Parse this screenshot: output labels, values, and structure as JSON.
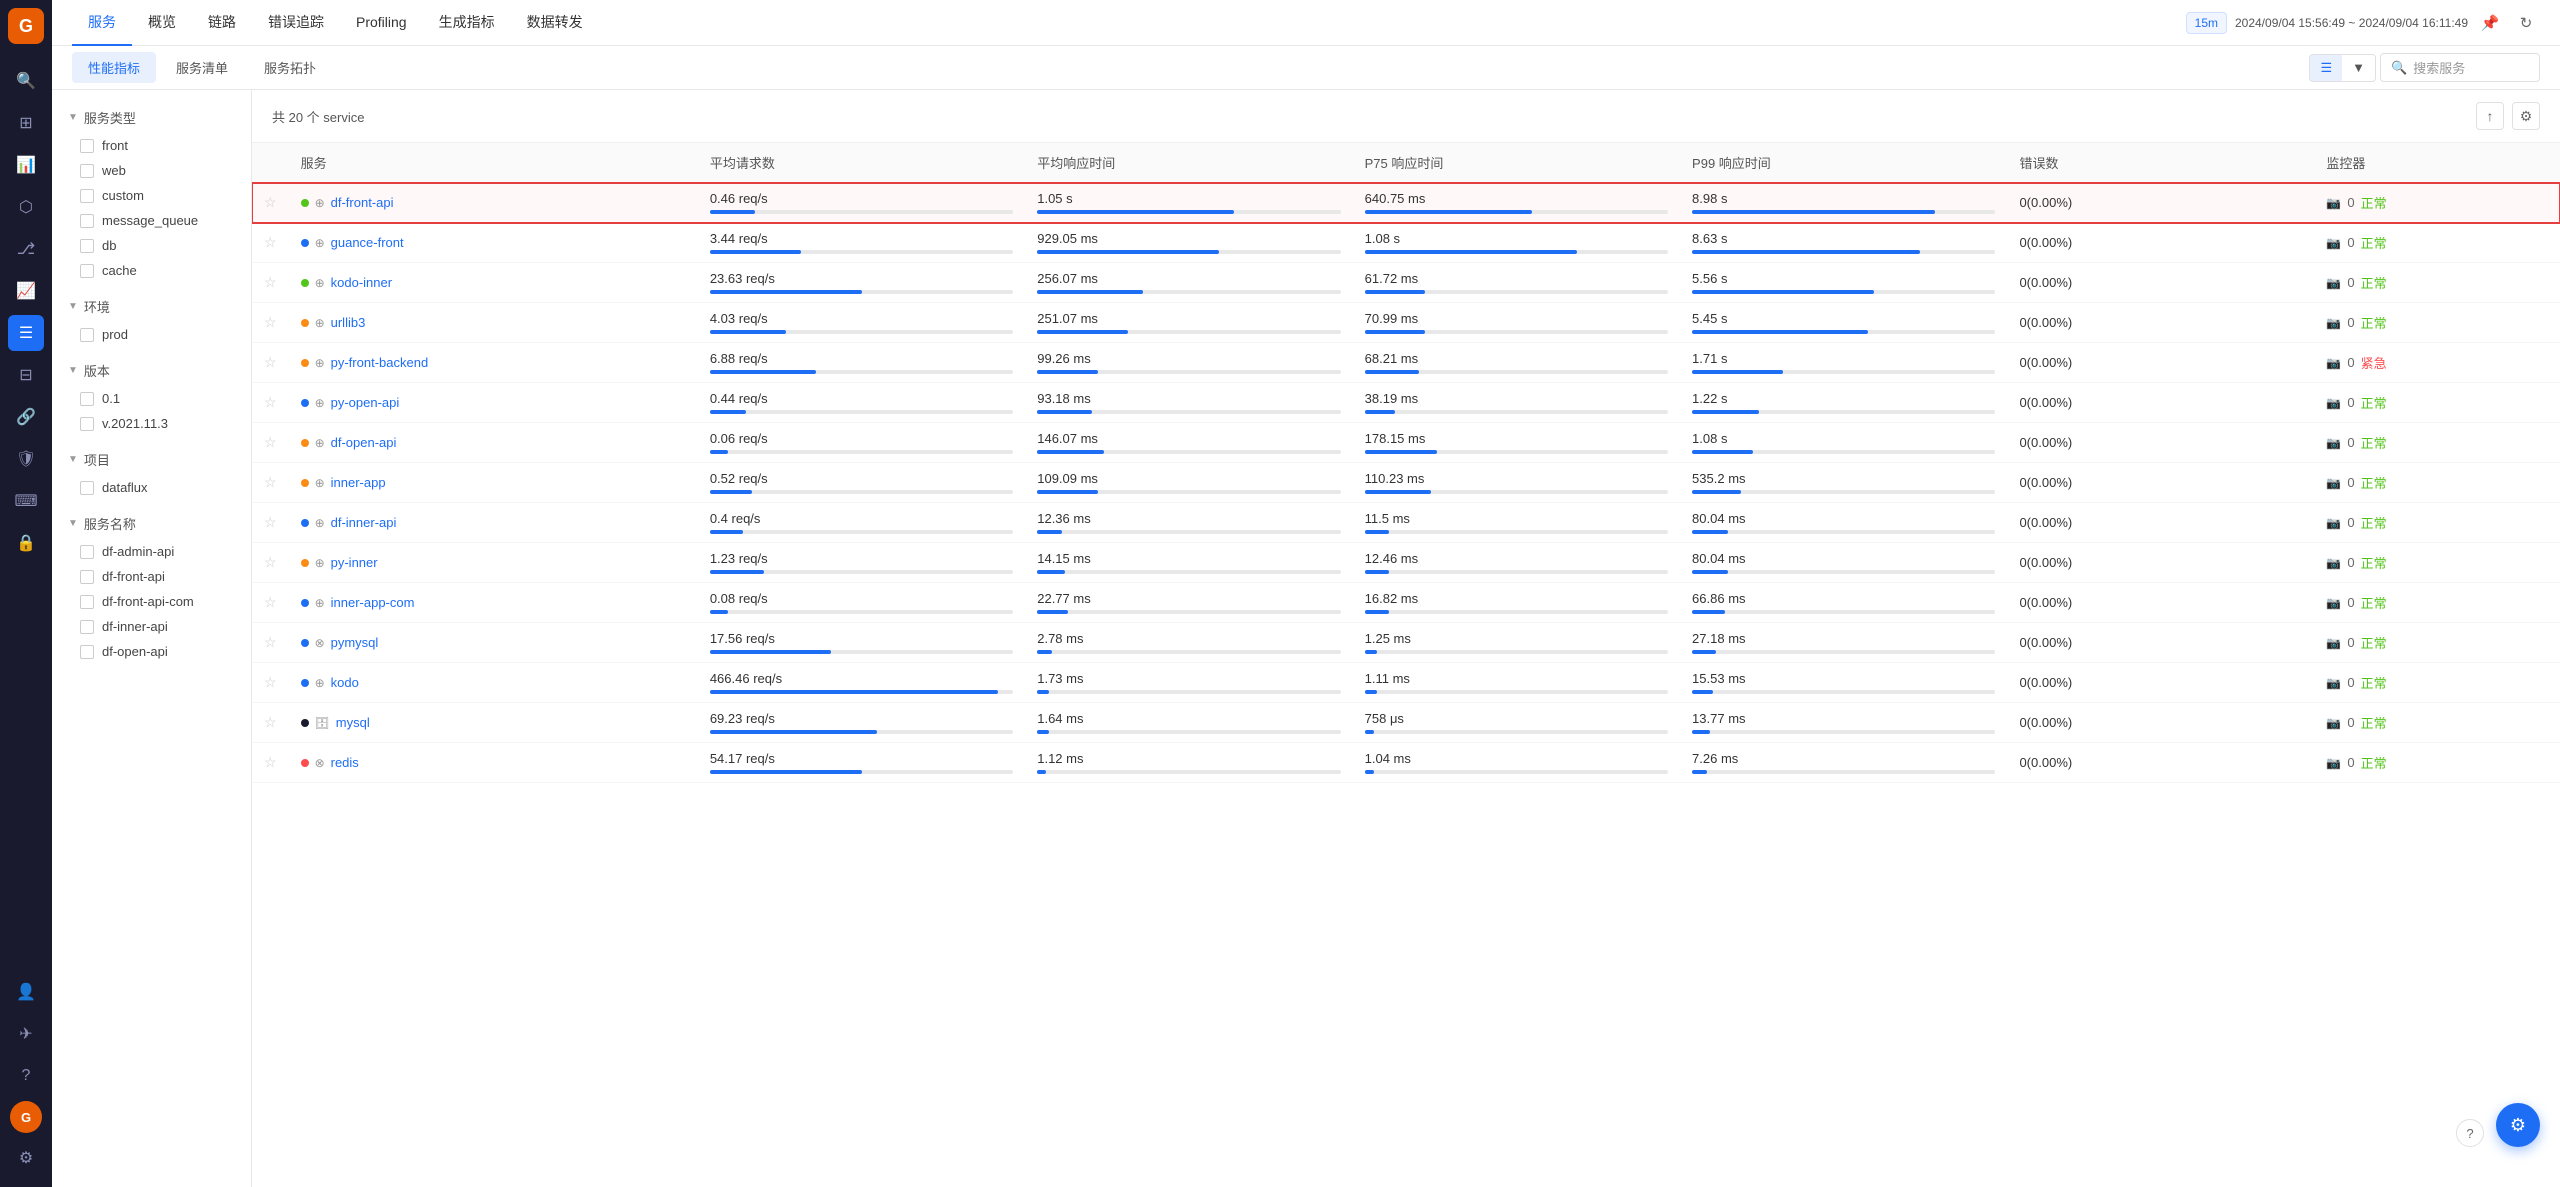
{
  "sidebar": {
    "logo": "G",
    "icons": [
      {
        "name": "search",
        "symbol": "🔍",
        "active": false
      },
      {
        "name": "dashboard",
        "symbol": "⊞",
        "active": false
      },
      {
        "name": "chart-bar",
        "symbol": "📊",
        "active": false
      },
      {
        "name": "topology",
        "symbol": "⬡",
        "active": false
      },
      {
        "name": "branch",
        "symbol": "⎇",
        "active": false
      },
      {
        "name": "analytics",
        "symbol": "📈",
        "active": false
      },
      {
        "name": "list",
        "symbol": "☰",
        "active": true
      },
      {
        "name": "grid",
        "symbol": "⊟",
        "active": false
      },
      {
        "name": "link",
        "symbol": "🔗",
        "active": false
      },
      {
        "name": "shield",
        "symbol": "🛡",
        "active": false
      },
      {
        "name": "terminal",
        "symbol": "⌨",
        "active": false
      },
      {
        "name": "lock",
        "symbol": "🔒",
        "active": false
      },
      {
        "name": "settings-bottom",
        "symbol": "⚙",
        "active": false
      }
    ],
    "bottom_icons": [
      {
        "name": "user-search",
        "symbol": "👤"
      },
      {
        "name": "send",
        "symbol": "✈"
      },
      {
        "name": "help",
        "symbol": "?"
      }
    ],
    "avatar": "G"
  },
  "nav": {
    "items": [
      {
        "label": "服务",
        "active": true
      },
      {
        "label": "概览",
        "active": false
      },
      {
        "label": "链路",
        "active": false
      },
      {
        "label": "错误追踪",
        "active": false
      },
      {
        "label": "Profiling",
        "active": false
      },
      {
        "label": "生成指标",
        "active": false
      },
      {
        "label": "数据转发",
        "active": false
      }
    ],
    "time_range": "15m",
    "time_start": "2024/09/04 15:56:49",
    "time_end": "2024/09/04 16:11:49"
  },
  "sub_tabs": [
    {
      "label": "性能指标",
      "active": true
    },
    {
      "label": "服务清单",
      "active": false
    },
    {
      "label": "服务拓扑",
      "active": false
    }
  ],
  "search_placeholder": "搜索服务",
  "filter": {
    "sections": [
      {
        "label": "服务类型",
        "items": [
          {
            "label": "front",
            "checked": false
          },
          {
            "label": "web",
            "checked": false
          },
          {
            "label": "custom",
            "checked": false
          },
          {
            "label": "message_queue",
            "checked": false
          },
          {
            "label": "db",
            "checked": false
          },
          {
            "label": "cache",
            "checked": false
          }
        ]
      },
      {
        "label": "环境",
        "items": [
          {
            "label": "prod",
            "checked": false
          }
        ]
      },
      {
        "label": "版本",
        "items": [
          {
            "label": "0.1",
            "checked": false
          },
          {
            "label": "v.2021.11.3",
            "checked": false
          }
        ]
      },
      {
        "label": "项目",
        "items": [
          {
            "label": "dataflux",
            "checked": false
          }
        ]
      },
      {
        "label": "服务名称",
        "items": [
          {
            "label": "df-admin-api",
            "checked": false
          },
          {
            "label": "df-front-api",
            "checked": false
          },
          {
            "label": "df-front-api-com",
            "checked": false
          },
          {
            "label": "df-inner-api",
            "checked": false
          },
          {
            "label": "df-open-api",
            "checked": false
          }
        ]
      }
    ]
  },
  "table": {
    "count_label": "共 20 个 service",
    "columns": [
      "服务",
      "平均请求数",
      "平均响应时间",
      "P75 响应时间",
      "P99 响应时间",
      "错误数",
      "监控器"
    ],
    "rows": [
      {
        "starred": false,
        "dot_color": "#52c41a",
        "icon_type": "globe",
        "name": "df-front-api",
        "highlighted": true,
        "avg_req": "0.46 req/s",
        "avg_req_bar": 15,
        "avg_resp": "1.05 s",
        "avg_resp_bar": 65,
        "p75": "640.75 ms",
        "p75_bar": 55,
        "p99": "8.98 s",
        "p99_bar": 80,
        "errors": "0(0.00%)",
        "monitor_count": "0",
        "monitor_status": "正常",
        "monitor_status_class": "normal"
      },
      {
        "starred": false,
        "dot_color": "#1e6ef5",
        "icon_type": "globe",
        "name": "guance-front",
        "highlighted": false,
        "avg_req": "3.44 req/s",
        "avg_req_bar": 30,
        "avg_resp": "929.05 ms",
        "avg_resp_bar": 60,
        "p75": "1.08 s",
        "p75_bar": 70,
        "p99": "8.63 s",
        "p99_bar": 75,
        "errors": "0(0.00%)",
        "monitor_count": "0",
        "monitor_status": "正常",
        "monitor_status_class": "normal"
      },
      {
        "starred": false,
        "dot_color": "#52c41a",
        "icon_type": "globe",
        "name": "kodo-inner",
        "highlighted": false,
        "avg_req": "23.63 req/s",
        "avg_req_bar": 50,
        "avg_resp": "256.07 ms",
        "avg_resp_bar": 35,
        "p75": "61.72 ms",
        "p75_bar": 20,
        "p99": "5.56 s",
        "p99_bar": 60,
        "errors": "0(0.00%)",
        "monitor_count": "0",
        "monitor_status": "正常",
        "monitor_status_class": "normal"
      },
      {
        "starred": false,
        "dot_color": "#fa8c16",
        "icon_type": "globe",
        "name": "urllib3",
        "highlighted": false,
        "avg_req": "4.03 req/s",
        "avg_req_bar": 25,
        "avg_resp": "251.07 ms",
        "avg_resp_bar": 30,
        "p75": "70.99 ms",
        "p75_bar": 20,
        "p99": "5.45 s",
        "p99_bar": 58,
        "errors": "0(0.00%)",
        "monitor_count": "0",
        "monitor_status": "正常",
        "monitor_status_class": "normal"
      },
      {
        "starred": false,
        "dot_color": "#fa8c16",
        "icon_type": "globe",
        "name": "py-front-backend",
        "highlighted": false,
        "avg_req": "6.88 req/s",
        "avg_req_bar": 35,
        "avg_resp": "99.26 ms",
        "avg_resp_bar": 20,
        "p75": "68.21 ms",
        "p75_bar": 18,
        "p99": "1.71 s",
        "p99_bar": 30,
        "errors": "0(0.00%)",
        "monitor_count": "0",
        "monitor_status": "紧急",
        "monitor_status_class": "urgent"
      },
      {
        "starred": false,
        "dot_color": "#1e6ef5",
        "icon_type": "globe",
        "name": "py-open-api",
        "highlighted": false,
        "avg_req": "0.44 req/s",
        "avg_req_bar": 12,
        "avg_resp": "93.18 ms",
        "avg_resp_bar": 18,
        "p75": "38.19 ms",
        "p75_bar": 10,
        "p99": "1.22 s",
        "p99_bar": 22,
        "errors": "0(0.00%)",
        "monitor_count": "0",
        "monitor_status": "正常",
        "monitor_status_class": "normal"
      },
      {
        "starred": false,
        "dot_color": "#fa8c16",
        "icon_type": "globe",
        "name": "df-open-api",
        "highlighted": false,
        "avg_req": "0.06 req/s",
        "avg_req_bar": 6,
        "avg_resp": "146.07 ms",
        "avg_resp_bar": 22,
        "p75": "178.15 ms",
        "p75_bar": 24,
        "p99": "1.08 s",
        "p99_bar": 20,
        "errors": "0(0.00%)",
        "monitor_count": "0",
        "monitor_status": "正常",
        "monitor_status_class": "normal"
      },
      {
        "starred": false,
        "dot_color": "#fa8c16",
        "icon_type": "globe",
        "name": "inner-app",
        "highlighted": false,
        "avg_req": "0.52 req/s",
        "avg_req_bar": 14,
        "avg_resp": "109.09 ms",
        "avg_resp_bar": 20,
        "p75": "110.23 ms",
        "p75_bar": 22,
        "p99": "535.2 ms",
        "p99_bar": 16,
        "errors": "0(0.00%)",
        "monitor_count": "0",
        "monitor_status": "正常",
        "monitor_status_class": "normal"
      },
      {
        "starred": false,
        "dot_color": "#1e6ef5",
        "icon_type": "globe",
        "name": "df-inner-api",
        "highlighted": false,
        "avg_req": "0.4 req/s",
        "avg_req_bar": 11,
        "avg_resp": "12.36 ms",
        "avg_resp_bar": 8,
        "p75": "11.5 ms",
        "p75_bar": 8,
        "p99": "80.04 ms",
        "p99_bar": 12,
        "errors": "0(0.00%)",
        "monitor_count": "0",
        "monitor_status": "正常",
        "monitor_status_class": "normal"
      },
      {
        "starred": false,
        "dot_color": "#fa8c16",
        "icon_type": "globe",
        "name": "py-inner",
        "highlighted": false,
        "avg_req": "1.23 req/s",
        "avg_req_bar": 18,
        "avg_resp": "14.15 ms",
        "avg_resp_bar": 9,
        "p75": "12.46 ms",
        "p75_bar": 8,
        "p99": "80.04 ms",
        "p99_bar": 12,
        "errors": "0(0.00%)",
        "monitor_count": "0",
        "monitor_status": "正常",
        "monitor_status_class": "normal"
      },
      {
        "starred": false,
        "dot_color": "#1e6ef5",
        "icon_type": "globe",
        "name": "inner-app-com",
        "highlighted": false,
        "avg_req": "0.08 req/s",
        "avg_req_bar": 6,
        "avg_resp": "22.77 ms",
        "avg_resp_bar": 10,
        "p75": "16.82 ms",
        "p75_bar": 8,
        "p99": "66.86 ms",
        "p99_bar": 11,
        "errors": "0(0.00%)",
        "monitor_count": "0",
        "monitor_status": "正常",
        "monitor_status_class": "normal"
      },
      {
        "starred": false,
        "dot_color": "#1e6ef5",
        "icon_type": "custom",
        "name": "pymysql",
        "highlighted": false,
        "avg_req": "17.56 req/s",
        "avg_req_bar": 40,
        "avg_resp": "2.78 ms",
        "avg_resp_bar": 5,
        "p75": "1.25 ms",
        "p75_bar": 4,
        "p99": "27.18 ms",
        "p99_bar": 8,
        "errors": "0(0.00%)",
        "monitor_count": "0",
        "monitor_status": "正常",
        "monitor_status_class": "normal"
      },
      {
        "starred": false,
        "dot_color": "#1e6ef5",
        "icon_type": "globe",
        "name": "kodo",
        "highlighted": false,
        "avg_req": "466.46 req/s",
        "avg_req_bar": 95,
        "avg_resp": "1.73 ms",
        "avg_resp_bar": 4,
        "p75": "1.11 ms",
        "p75_bar": 4,
        "p99": "15.53 ms",
        "p99_bar": 7,
        "errors": "0(0.00%)",
        "monitor_count": "0",
        "monitor_status": "正常",
        "monitor_status_class": "normal"
      },
      {
        "starred": false,
        "dot_color": "#1a1a2e",
        "icon_type": "db",
        "name": "mysql",
        "highlighted": false,
        "avg_req": "69.23 req/s",
        "avg_req_bar": 55,
        "avg_resp": "1.64 ms",
        "avg_resp_bar": 4,
        "p75": "758 μs",
        "p75_bar": 3,
        "p99": "13.77 ms",
        "p99_bar": 6,
        "errors": "0(0.00%)",
        "monitor_count": "0",
        "monitor_status": "正常",
        "monitor_status_class": "normal"
      },
      {
        "starred": false,
        "dot_color": "#ff4d4f",
        "icon_type": "custom",
        "name": "redis",
        "highlighted": false,
        "avg_req": "54.17 req/s",
        "avg_req_bar": 50,
        "avg_resp": "1.12 ms",
        "avg_resp_bar": 3,
        "p75": "1.04 ms",
        "p75_bar": 3,
        "p99": "7.26 ms",
        "p99_bar": 5,
        "errors": "0(0.00%)",
        "monitor_count": "0",
        "monitor_status": "正常",
        "monitor_status_class": "normal"
      }
    ]
  }
}
